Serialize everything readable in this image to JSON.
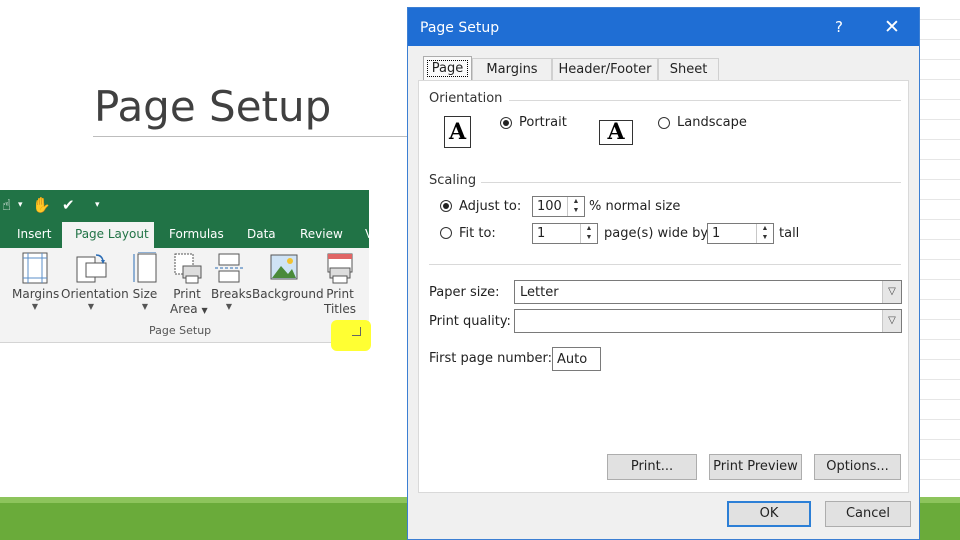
{
  "slide": {
    "title": "Page Setup"
  },
  "ribbon": {
    "tabs": [
      "Insert",
      "Page Layout",
      "Formulas",
      "Data",
      "Review",
      "V"
    ],
    "buttons": [
      {
        "label": "Margins",
        "icon": "margins-icon"
      },
      {
        "label": "Orientation",
        "icon": "orientation-icon"
      },
      {
        "label": "Size",
        "icon": "size-icon"
      },
      {
        "label": "Print",
        "label2": "Area",
        "icon": "print-area-icon"
      },
      {
        "label": "Breaks",
        "icon": "breaks-icon"
      },
      {
        "label": "Background",
        "icon": "background-icon"
      },
      {
        "label": "Print",
        "label2": "Titles",
        "icon": "print-titles-icon"
      }
    ],
    "group_label": "Page Setup",
    "accent": "#217346",
    "highlight": "#ffff33"
  },
  "dialog": {
    "title": "Page Setup",
    "help": "?",
    "close": "✕",
    "tabs": [
      "Page",
      "Margins",
      "Header/Footer",
      "Sheet"
    ],
    "orientation": {
      "heading": "Orientation",
      "portrait": "Portrait",
      "landscape": "Landscape",
      "icon_glyph": "A",
      "selected": "Portrait"
    },
    "scaling": {
      "heading": "Scaling",
      "adjust_label": "Adjust to:",
      "adjust_value": "100",
      "adjust_suffix": "% normal size",
      "fit_label": "Fit to:",
      "fit_wide_value": "1",
      "fit_wide_suffix": "page(s) wide by",
      "fit_tall_value": "1",
      "fit_tall_suffix": "tall",
      "selected": "Adjust to"
    },
    "paper_size": {
      "label": "Paper size:",
      "value": "Letter"
    },
    "print_quality": {
      "label": "Print quality:",
      "value": ""
    },
    "first_page": {
      "label": "First page number:",
      "value": "Auto"
    },
    "buttons": {
      "print": "Print...",
      "preview": "Print Preview",
      "options": "Options...",
      "ok": "OK",
      "cancel": "Cancel"
    },
    "title_color": "#1f6ed4"
  }
}
